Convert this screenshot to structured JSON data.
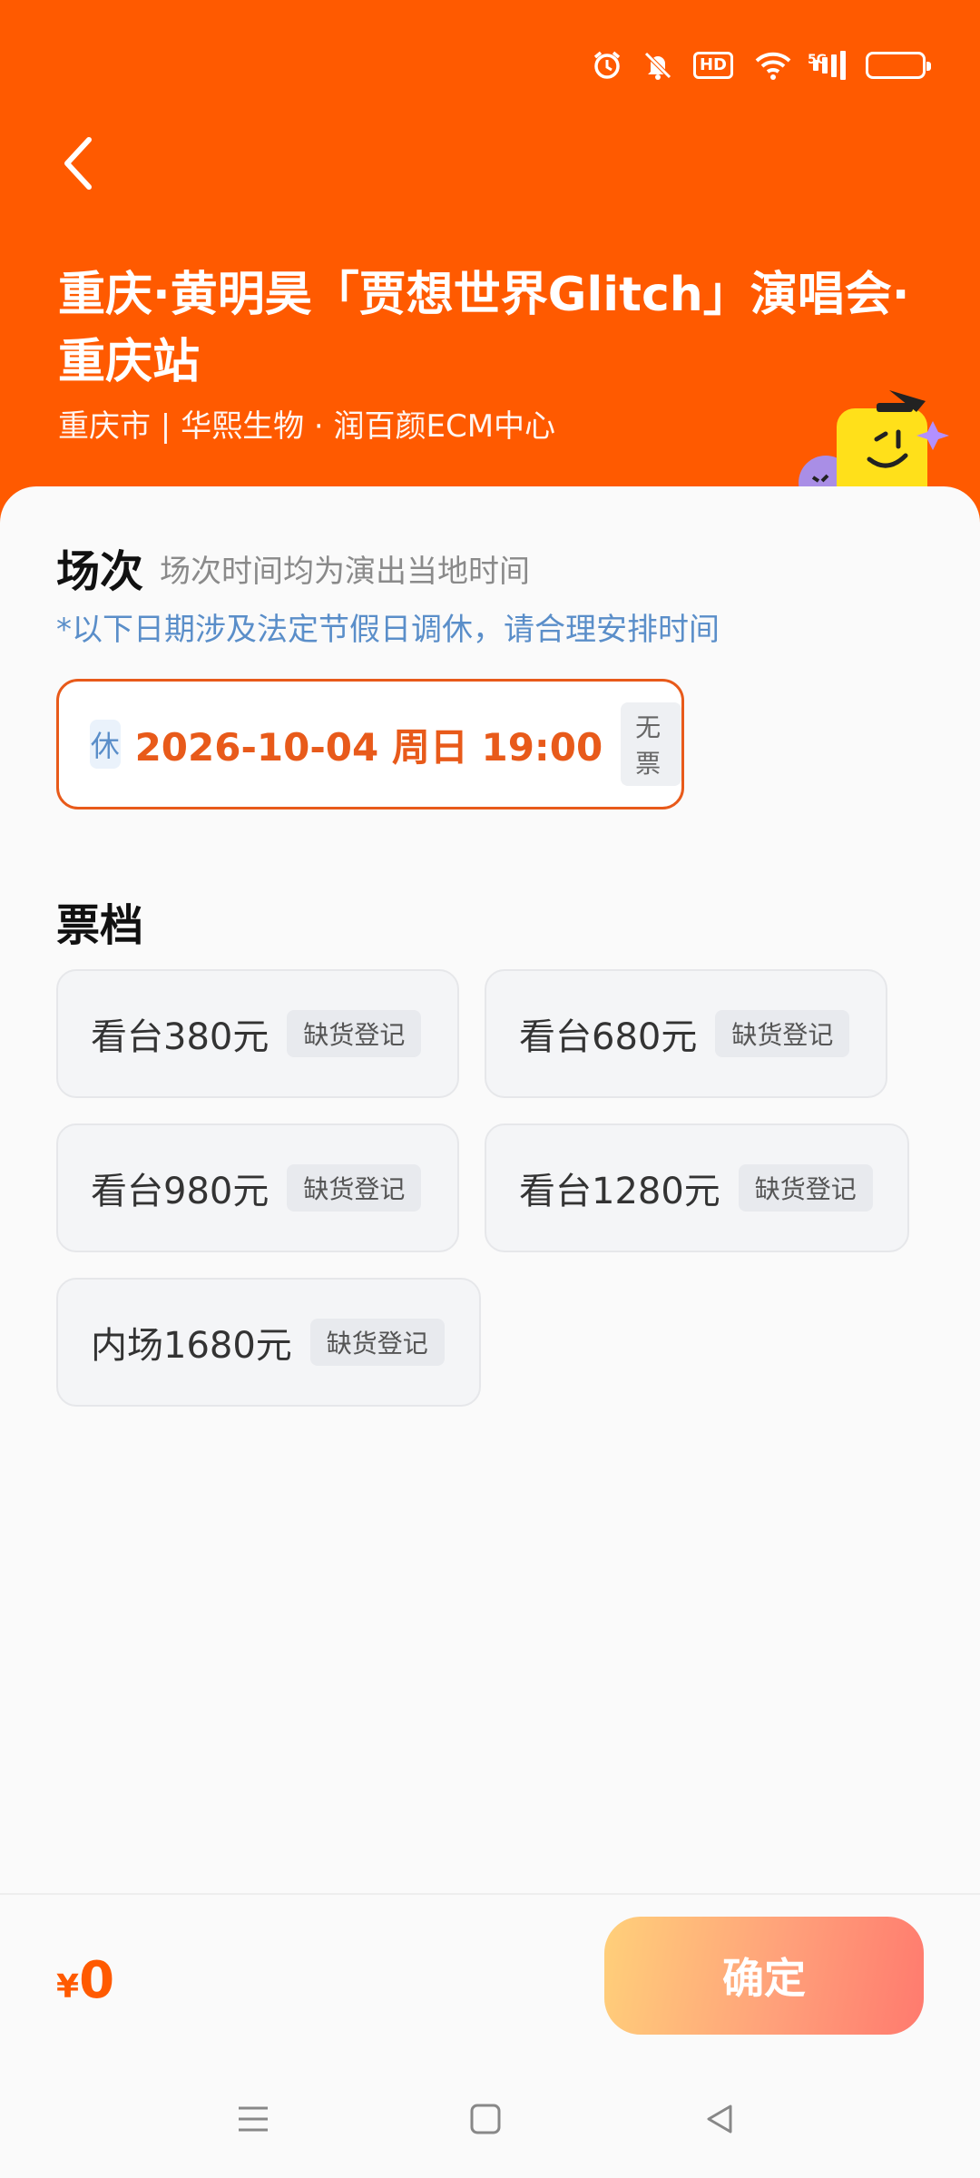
{
  "event": {
    "title": "重庆·黄明昊「贾想世界Glitch」演唱会·重庆站",
    "venue": "重庆市 | 华熙生物 · 润百颜ECM中心"
  },
  "sessions": {
    "title": "场次",
    "subtitle": "场次时间均为演出当地时间",
    "notice": "*以下日期涉及法定节假日调休，请合理安排时间",
    "items": [
      {
        "badge": "休",
        "datetime": "2026-10-04  周日 19:00",
        "status": "无票"
      }
    ]
  },
  "tickets": {
    "title": "票档",
    "items": [
      {
        "label": "看台380元",
        "action": "缺货登记"
      },
      {
        "label": "看台680元",
        "action": "缺货登记"
      },
      {
        "label": "看台980元",
        "action": "缺货登记"
      },
      {
        "label": "看台1280元",
        "action": "缺货登记"
      },
      {
        "label": "内场1680元",
        "action": "缺货登记"
      }
    ]
  },
  "footer": {
    "currency": "¥",
    "total": "0",
    "confirm_label": "确定"
  },
  "status_bar": {
    "network_label": "5G",
    "hd_label": "HD",
    "icons": [
      "alarm-icon",
      "mute-icon",
      "hd-icon",
      "wifi-icon",
      "signal-icon",
      "battery-icon"
    ]
  },
  "colors": {
    "brand": "#ff5a00",
    "accent": "#e85a1a",
    "notice": "#5a8ec9"
  }
}
